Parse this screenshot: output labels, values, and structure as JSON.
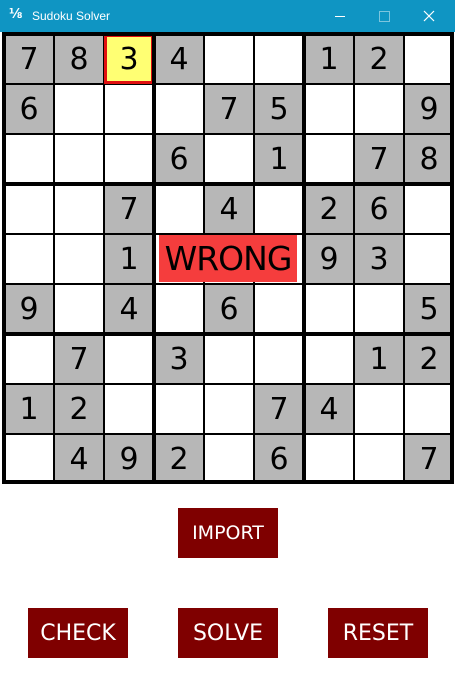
{
  "window": {
    "title": "Sudoku Solver",
    "icon_glyph": "⅛"
  },
  "grid": {
    "rows": [
      [
        "7",
        "8",
        "3",
        "4",
        "",
        "",
        "1",
        "2",
        ""
      ],
      [
        "6",
        "",
        "",
        "",
        "7",
        "5",
        "",
        "",
        "9"
      ],
      [
        "",
        "",
        "",
        "6",
        "",
        "1",
        "",
        "7",
        "8"
      ],
      [
        "",
        "",
        "7",
        "",
        "4",
        "",
        "2",
        "6",
        ""
      ],
      [
        "",
        "",
        "1",
        "",
        "",
        "",
        "9",
        "3",
        ""
      ],
      [
        "9",
        "",
        "4",
        "",
        "6",
        "",
        "",
        "",
        "5"
      ],
      [
        "",
        "7",
        "",
        "3",
        "",
        "",
        "",
        "1",
        "2"
      ],
      [
        "1",
        "2",
        "",
        "",
        "",
        "7",
        "4",
        "",
        ""
      ],
      [
        "",
        "4",
        "9",
        "2",
        "",
        "6",
        "",
        "",
        "7"
      ]
    ],
    "given": [
      [
        1,
        1,
        0,
        1,
        0,
        0,
        1,
        1,
        0
      ],
      [
        1,
        0,
        0,
        0,
        1,
        1,
        0,
        0,
        1
      ],
      [
        0,
        0,
        0,
        1,
        0,
        1,
        0,
        1,
        1
      ],
      [
        0,
        0,
        1,
        0,
        1,
        0,
        1,
        1,
        0
      ],
      [
        0,
        0,
        1,
        0,
        0,
        0,
        1,
        1,
        0
      ],
      [
        1,
        0,
        1,
        0,
        1,
        0,
        0,
        0,
        1
      ],
      [
        0,
        1,
        0,
        1,
        0,
        0,
        0,
        1,
        1
      ],
      [
        1,
        1,
        0,
        0,
        0,
        1,
        1,
        0,
        0
      ],
      [
        0,
        1,
        1,
        1,
        0,
        1,
        0,
        0,
        1
      ]
    ],
    "selected": [
      0,
      2
    ],
    "status_text": "WRONG"
  },
  "buttons": {
    "import": "IMPORT",
    "check": "CHECK",
    "solve": "SOLVE",
    "reset": "RESET"
  },
  "colors": {
    "titlebar": "#0f95c3",
    "given_cell": "#b7b7b7",
    "selected_cell": "#ffff73",
    "selected_border": "#e01010",
    "wrong_badge": "#f53d3d",
    "button": "#7f0000"
  }
}
